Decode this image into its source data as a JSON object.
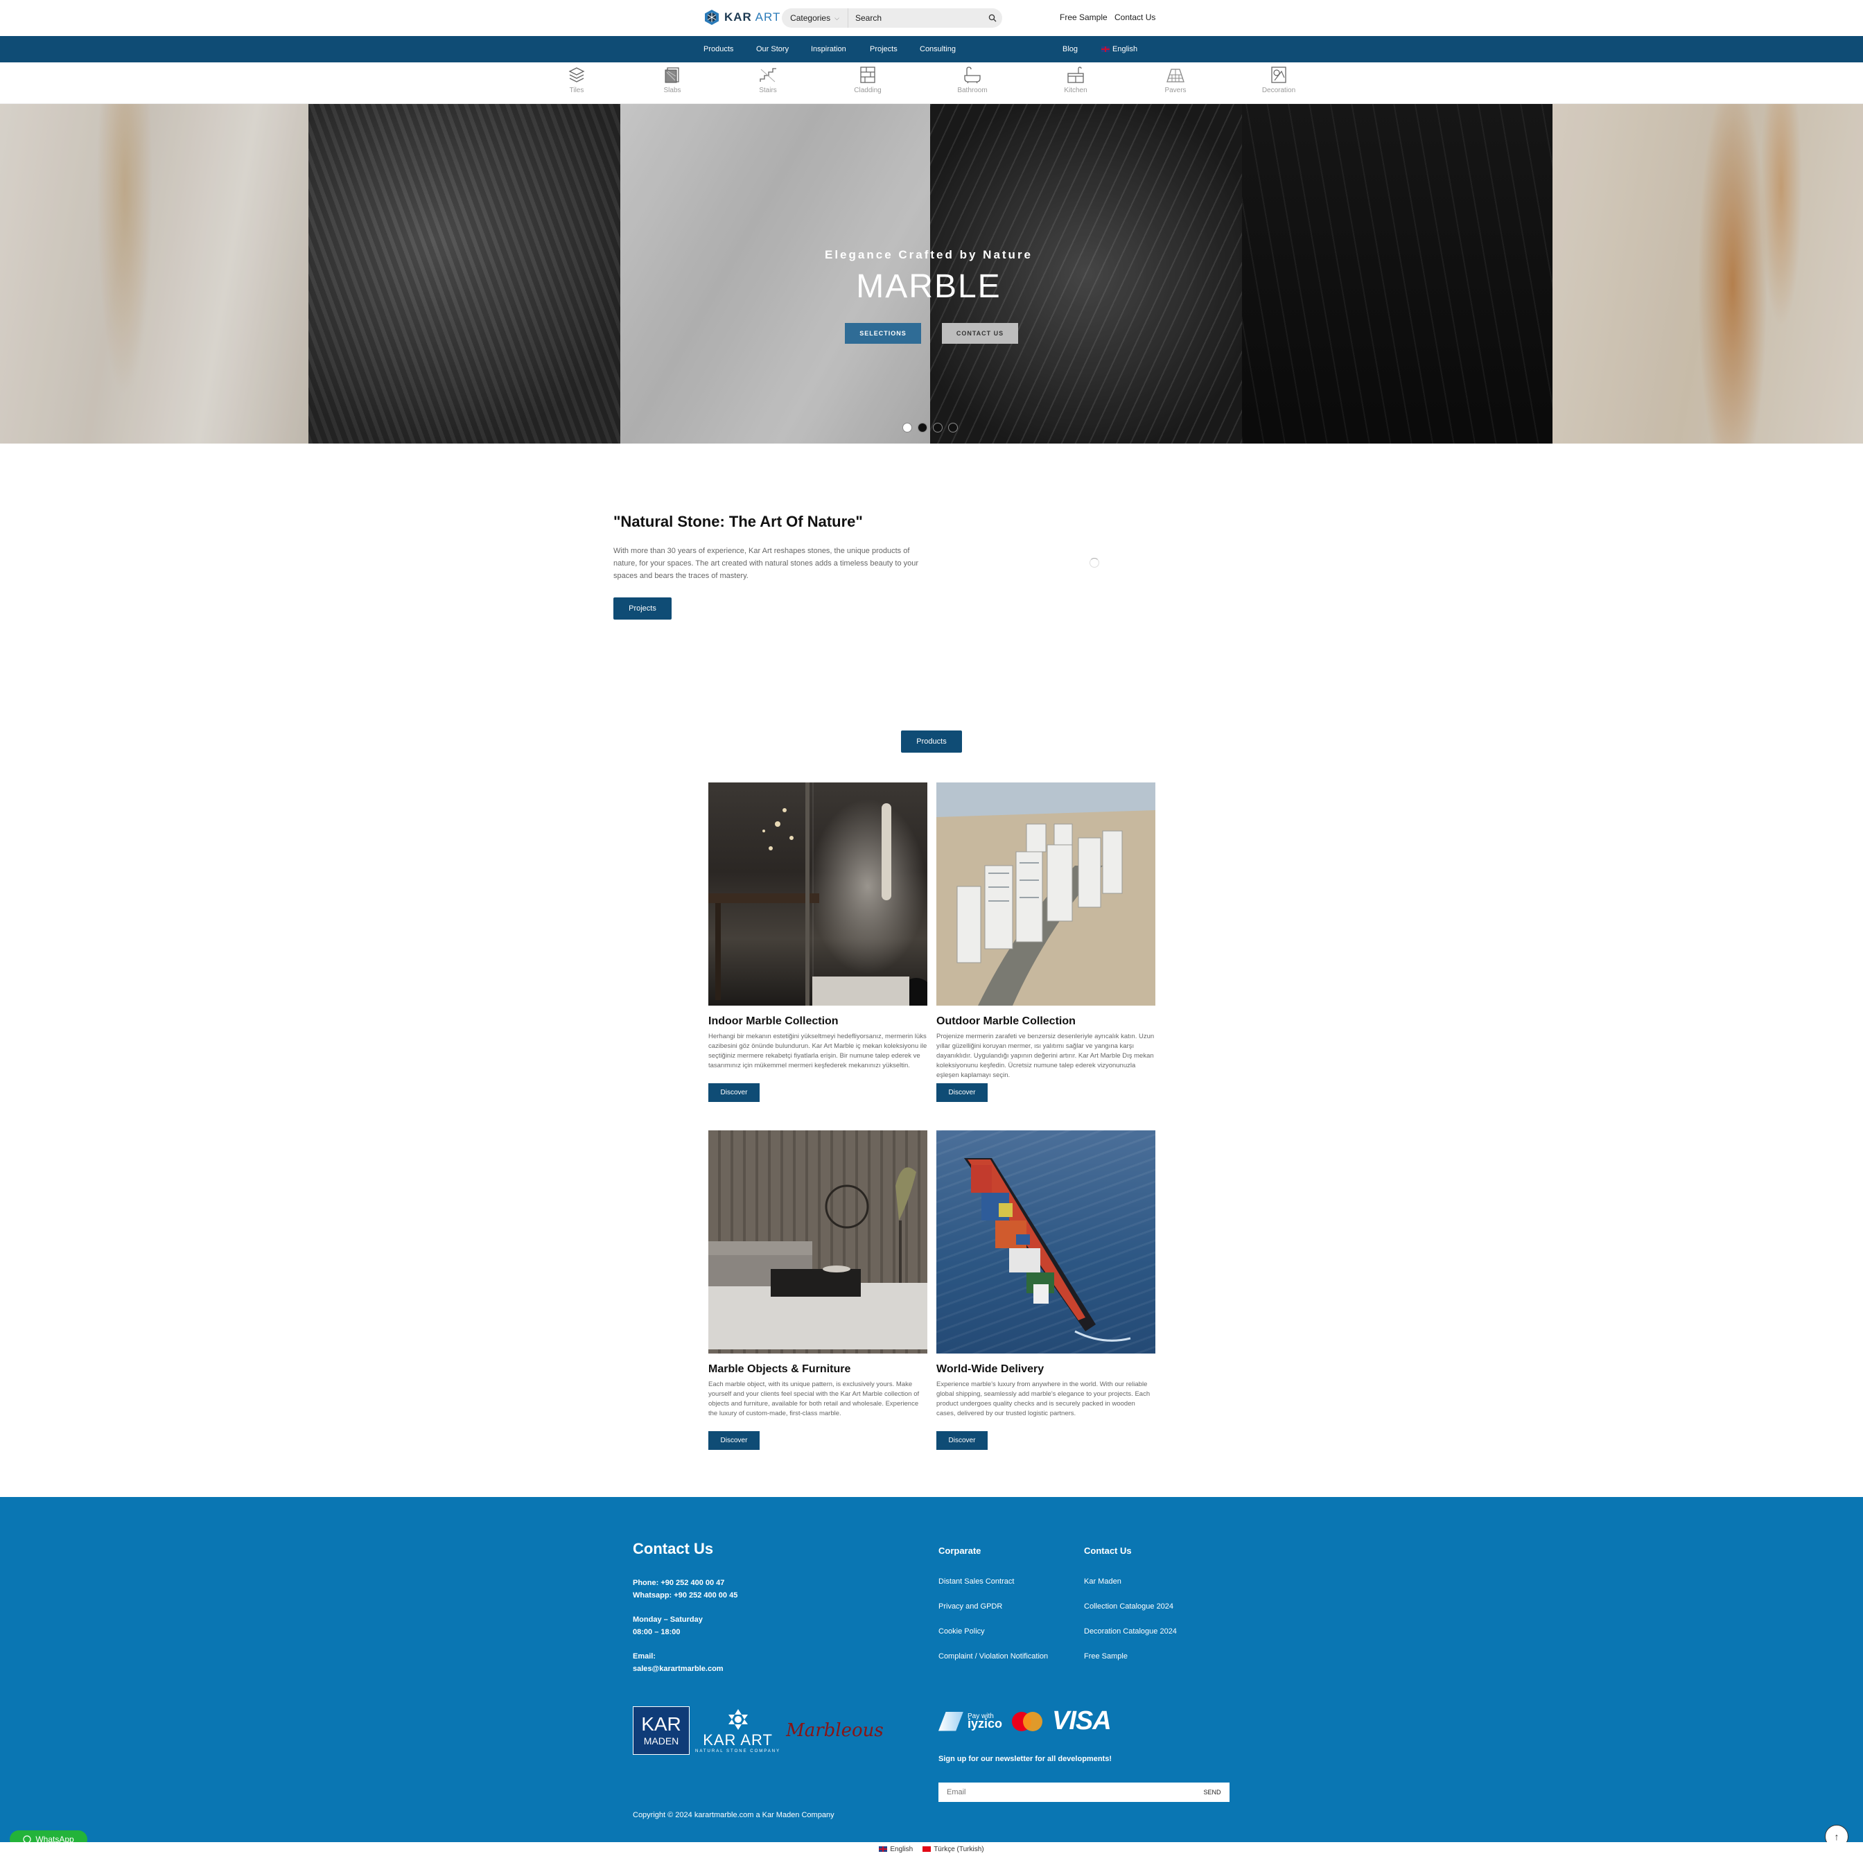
{
  "header": {
    "logo_bold": "KAR",
    "logo_light": "ART",
    "categories_label": "Categories",
    "search_placeholder": "Search",
    "free_sample": "Free Sample",
    "contact_us": "Contact Us"
  },
  "nav": {
    "items": [
      "Products",
      "Our Story",
      "Inspiration",
      "Projects",
      "Consulting"
    ],
    "blog": "Blog",
    "language": "English"
  },
  "categories": [
    {
      "label": "Tiles",
      "icon": "tiles-icon"
    },
    {
      "label": "Slabs",
      "icon": "slabs-icon"
    },
    {
      "label": "Stairs",
      "icon": "stairs-icon"
    },
    {
      "label": "Cladding",
      "icon": "cladding-icon"
    },
    {
      "label": "Bathroom",
      "icon": "bathroom-icon"
    },
    {
      "label": "Kitchen",
      "icon": "kitchen-icon"
    },
    {
      "label": "Pavers",
      "icon": "pavers-icon"
    },
    {
      "label": "Decoration",
      "icon": "decoration-icon"
    }
  ],
  "hero": {
    "subtitle": "Elegance Crafted by Nature",
    "title": "MARBLE",
    "btn_selections": "SELECTIONS",
    "btn_contact": "CONTACT US",
    "slide_count": 4,
    "active_slide": 1
  },
  "intro": {
    "title": "\"Natural Stone: The Art Of Nature\"",
    "text": "With more than 30 years of experience, Kar Art reshapes stones, the unique products of nature, for your spaces. The art created with natural stones adds a timeless beauty to your spaces and bears the traces of mastery.",
    "button": "Projects"
  },
  "products_button": "Products",
  "products": [
    {
      "title": "Indoor Marble Collection",
      "text": "Herhangi bir mekanın estetiğini yükseltmeyi hedefliyorsanız, mermerin lüks cazibesini göz önünde bulundurun. Kar Art Marble iç mekan koleksiyonu ile seçtiğiniz mermere rekabetçi fiyatlarla erişin. Bir numune talep ederek ve tasarımınız için mükemmel mermeri keşfederek mekanınızı yükseltin.",
      "button": "Discover"
    },
    {
      "title": "Outdoor Marble Collection",
      "text": "Projenize mermerin zarafeti ve benzersiz desenleriyle ayrıcalık katın. Uzun yıllar güzelliğini koruyan mermer, ısı yalıtımı sağlar ve yangına karşı dayanıklıdır. Uygulandığı yapının değerini artırır. Kar Art Marble Dış mekan koleksiyonunu keşfedin. Ücretsiz numune talep ederek vizyonunuzla eşleşen kaplamayı seçin.",
      "button": "Discover"
    },
    {
      "title": "Marble Objects & Furniture",
      "text": "Each marble object, with its unique pattern, is exclusively yours. Make yourself and your clients feel special with the Kar Art Marble collection of objects and furniture, available for both retail and wholesale. Experience the luxury of custom-made, first-class marble.",
      "button": "Discover"
    },
    {
      "title": "World-Wide Delivery",
      "text": "Experience marble's luxury from anywhere in the world. With our reliable global shipping, seamlessly add marble's elegance to your projects. Each product undergoes quality checks and is securely packed in wooden cases, delivered by our trusted logistic partners.",
      "button": "Discover"
    }
  ],
  "footer": {
    "contact_title": "Contact Us",
    "phone": "Phone: +90 252 400 00 47",
    "whatsapp": "Whatsapp: +90 252 400 00 45",
    "days": "Monday – Saturday",
    "hours": "08:00 – 18:00",
    "email_label": "Email:",
    "email": "sales@karartmarble.com",
    "corporate_title": "Corparate",
    "corporate_links": [
      "Distant Sales Contract",
      "Privacy and GPDR",
      "Cookie Policy",
      "Complaint / Violation Notification"
    ],
    "contact_col_title": "Contact Us",
    "contact_links": [
      "Kar Maden",
      "Collection Catalogue 2024",
      "Decoration Catalogue 2024",
      "Free Sample"
    ],
    "karmaden_top": "KAR",
    "karmaden_bottom": "MADEN",
    "karart_logo": "KAR ART",
    "karart_tagline": "NATURAL STONE COMPANY",
    "marbleous": "Marbleous",
    "iyzico_pay": "Pay with",
    "iyzico_name": "iyzico",
    "visa": "VISA",
    "newsletter": "Sign up for our newsletter for all developments!",
    "email_placeholder": "Email",
    "send": "SEND",
    "copyright": "Copyright © 2024 karartmarble.com a Kar Maden Company"
  },
  "whatsapp_button": "WhatsApp",
  "languages": [
    "English",
    "Türkçe (Turkish)"
  ],
  "colors": {
    "nav": "#0f4c75",
    "footer": "#0a76b3",
    "whatsapp": "#23b33a"
  }
}
